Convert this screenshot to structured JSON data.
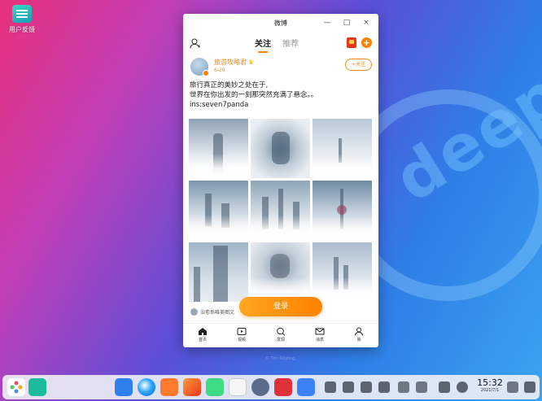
{
  "desktop": {
    "icons": [
      {
        "label": "用户反馈",
        "icon": "feedback-app-icon"
      }
    ]
  },
  "wallpaper": {
    "logo_text": "deepin",
    "caption": "© Tim Ribbing"
  },
  "window": {
    "title": "微博",
    "controls": {
      "minimize": "—",
      "maximize": "□",
      "close": "×"
    },
    "tabs": [
      {
        "label": "关注",
        "active": true
      },
      {
        "label": "推荐",
        "active": false
      }
    ],
    "post": {
      "author": "旅游攻略君",
      "time": "6-29",
      "follow_label": "+关注",
      "text_line1": "旅行真正的美妙之处在于,",
      "text_line2": "世界在你出发的一刻那突然充满了悬念。。",
      "text_line3": "ins:seven7panda",
      "photo_count": 9,
      "footer_note": "治愈系唯美图文"
    },
    "login_label": "登录",
    "bottom_nav": [
      {
        "label": "首页",
        "icon": "home-icon"
      },
      {
        "label": "视频",
        "icon": "video-icon"
      },
      {
        "label": "发现",
        "icon": "search-icon"
      },
      {
        "label": "消息",
        "icon": "mail-icon"
      },
      {
        "label": "我",
        "icon": "profile-icon"
      }
    ]
  },
  "taskbar": {
    "time": "15:32",
    "date": "2021/7/1"
  },
  "colors": {
    "accent": "#ff8200",
    "author": "#f08a1c"
  }
}
